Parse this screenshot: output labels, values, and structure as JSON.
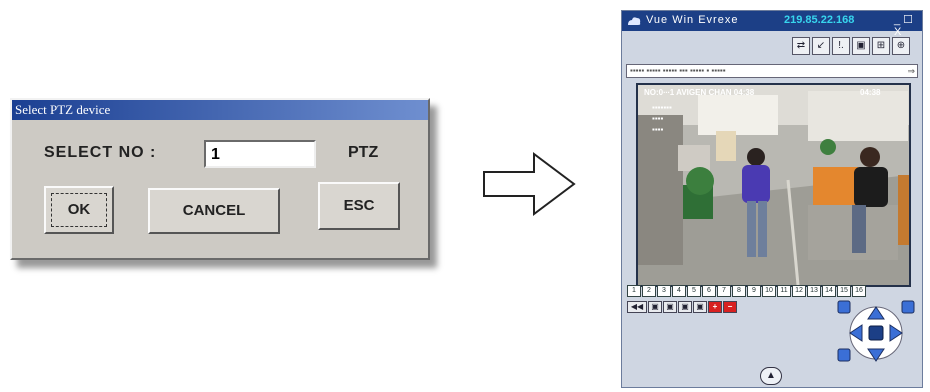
{
  "dialog": {
    "title": "Select PTZ device",
    "select_label": "SELECT  NO :",
    "input_value": "1",
    "suffix_label": "PTZ",
    "buttons": {
      "ok": "OK",
      "cancel": "CANCEL",
      "esc": "ESC"
    }
  },
  "viewer": {
    "title": "Vue  Win Evrexe",
    "ip": "219.85.22.168",
    "window_controls": "_ ☐ X",
    "address_bar": "▪▪▪▪▪ ▪▪▪▪▪ ▪▪▪▪▪ ▪▪▪ ▪▪▪▪▪  ▪  ▪▪▪▪▪",
    "address_go": "⇒",
    "osd_top_left": "NO:0∙∙∙1 AVIGEN CHAN 04:38",
    "osd_top_right": "04:38",
    "osd_lines": [
      "▪▪▪▪▪▪▪",
      "▪▪▪▪",
      "▪▪▪▪"
    ],
    "toolbar_icons": [
      "⇄",
      "↙",
      "!.",
      "▣",
      "⊞",
      "⊕"
    ],
    "channel_labels": [
      "1",
      "2",
      "3",
      "4",
      "5",
      "6",
      "7",
      "8",
      "9",
      "10",
      "11",
      "12",
      "13",
      "14",
      "15",
      "16"
    ],
    "control_icons": [
      "◀◀",
      "▣",
      "▣",
      "▣",
      "▣",
      "+",
      "−"
    ],
    "bottom_icon": "▲"
  },
  "accent_colors": {
    "dialog_title_bar": "#1b3f92",
    "viewer_title_bar": "#1c3f86",
    "ip_text": "#37d6ee",
    "ptz_pad": "#3b6fd6"
  }
}
